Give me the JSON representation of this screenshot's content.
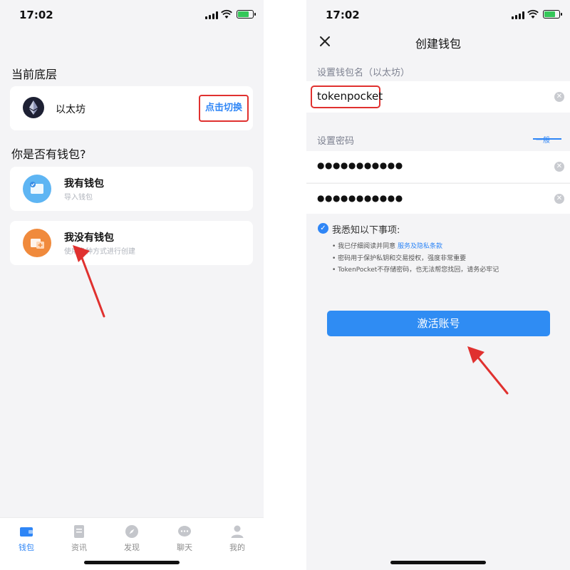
{
  "status": {
    "time": "17:02"
  },
  "left": {
    "layer_title": "当前底层",
    "chain_name": "以太坊",
    "switch_label": "点击切换",
    "question": "你是否有钱包?",
    "options": [
      {
        "title": "我有钱包",
        "subtitle": "导入钱包"
      },
      {
        "title": "我没有钱包",
        "subtitle": "使用多种方式进行创建"
      }
    ],
    "tabs": [
      {
        "label": "钱包",
        "active": true
      },
      {
        "label": "资讯",
        "active": false
      },
      {
        "label": "发现",
        "active": false
      },
      {
        "label": "聊天",
        "active": false
      },
      {
        "label": "我的",
        "active": false
      }
    ]
  },
  "right": {
    "title": "创建钱包",
    "wallet_name_label": "设置钱包名（以太坊）",
    "wallet_name_value": "tokenpocket",
    "password_label": "设置密码",
    "strength_label": "一般",
    "password_value": "●●●●●●●●●●●",
    "confirm_value": "●●●●●●●●●●●",
    "agree_title": "我悉知以下事项:",
    "bullet1_prefix": "• 我已仔细阅读并同意 ",
    "bullet1_link": "服务及隐私条款",
    "bullet2": "• 密码用于保护私钥和交易授权，强度非常重要",
    "bullet3": "• TokenPocket不存储密码，也无法帮您找回，请务必牢记",
    "activate_label": "激活账号"
  },
  "colors": {
    "accent": "#2f86f6",
    "highlight": "#e0312f",
    "button": "#2f8cf3"
  }
}
